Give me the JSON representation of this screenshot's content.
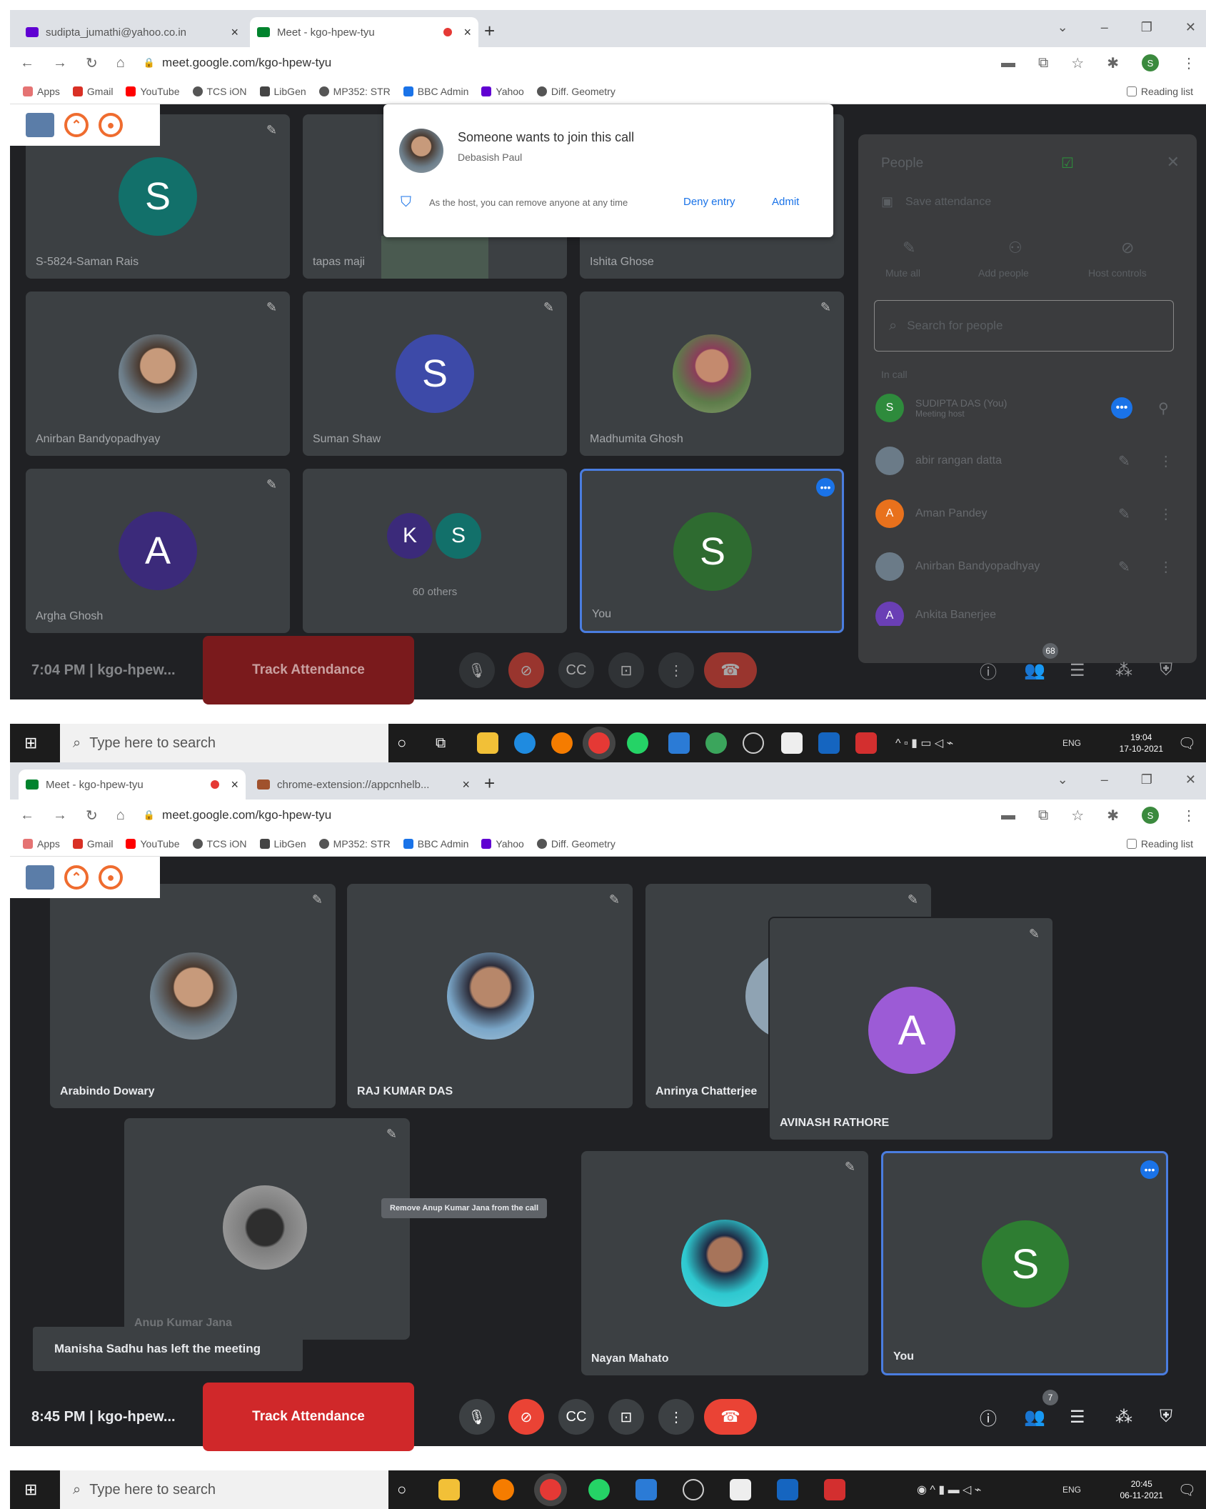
{
  "s1": {
    "tabs": [
      {
        "label": "sudipta_jumathi@yahoo.co.in"
      },
      {
        "label": "Meet - kgo-hpew-tyu"
      }
    ],
    "url": "meet.google.com/kgo-hpew-tyu",
    "bookmarks": [
      "Apps",
      "Gmail",
      "YouTube",
      "TCS iON",
      "LibGen",
      "MP352: STR",
      "BBC Admin",
      "Yahoo",
      "Diff. Geometry"
    ],
    "reading_list": "Reading list",
    "join": {
      "title": "Someone wants to join this call",
      "name": "Debasish Paul",
      "note": "As the host, you can remove anyone at any time",
      "deny": "Deny entry",
      "admit": "Admit"
    },
    "tiles": [
      {
        "name": "S-5824-Saman Rais",
        "initial": "S",
        "color": "#12706a"
      },
      {
        "name": "tapas maji"
      },
      {
        "name": "Ishita Ghose"
      },
      {
        "name": "Anirban Bandyopadhyay"
      },
      {
        "name": "Suman Shaw",
        "initial": "S",
        "color": "#3d4aa8"
      },
      {
        "name": "Madhumita Ghosh"
      },
      {
        "name": "Argha Ghosh",
        "initial": "A",
        "color": "#3b2a7a"
      },
      {
        "name": "60 others",
        "initials": [
          "K",
          "S"
        ]
      },
      {
        "name": "You",
        "initial": "S",
        "color": "#2e6b30"
      }
    ],
    "people": {
      "title": "People",
      "save": "Save attendance",
      "actions": [
        "Mute all",
        "Add people",
        "Host controls"
      ],
      "search_placeholder": "Search for people",
      "section": "In call",
      "rows": [
        {
          "name": "SUDIPTA DAS (You)",
          "sub": "Meeting host",
          "initial": "S",
          "color": "#2e8b3c"
        },
        {
          "name": "abir rangan datta",
          "initial": "",
          "color": "#6b7b88"
        },
        {
          "name": "Aman Pandey",
          "initial": "A",
          "color": "#e8711c"
        },
        {
          "name": "Anirban Bandyopadhyay",
          "initial": "",
          "color": "#6b7b88"
        },
        {
          "name": "Ankita Banerjee",
          "initial": "A",
          "color": "#6a3fb5"
        }
      ]
    },
    "bar": {
      "time": "7:04 PM",
      "code": "kgo-hpew...",
      "track": "Track Attendance",
      "people_count": "68"
    },
    "taskbar": {
      "search": "Type here to search",
      "time": "19:04",
      "date": "17-10-2021",
      "lang": "ENG"
    }
  },
  "s2": {
    "tabs": [
      {
        "label": "Meet - kgo-hpew-tyu"
      },
      {
        "label": "chrome-extension://appcnhelb..."
      }
    ],
    "url": "meet.google.com/kgo-hpew-tyu",
    "bookmarks": [
      "Apps",
      "Gmail",
      "YouTube",
      "TCS iON",
      "LibGen",
      "MP352: STR",
      "BBC Admin",
      "Yahoo",
      "Diff. Geometry"
    ],
    "reading_list": "Reading list",
    "tiles": [
      {
        "name": "Arabindo Dowary"
      },
      {
        "name": "RAJ KUMAR DAS"
      },
      {
        "name": "Anrinya Chatterjee"
      },
      {
        "name": "AVINASH RATHORE",
        "initial": "A",
        "color": "#9c5bd6"
      },
      {
        "name": "Anup Kumar Jana"
      },
      {
        "name": "Nayan Mahato"
      },
      {
        "name": "You",
        "initial": "S",
        "color": "#2e7d32"
      }
    ],
    "tooltip": "Remove Anup Kumar Jana from the call",
    "toast": "Manisha Sadhu has left the meeting",
    "bar": {
      "time": "8:45 PM",
      "code": "kgo-hpew...",
      "track": "Track Attendance",
      "people_count": "7"
    },
    "taskbar": {
      "search": "Type here to search",
      "time": "20:45",
      "date": "06-11-2021",
      "lang": "ENG"
    }
  }
}
